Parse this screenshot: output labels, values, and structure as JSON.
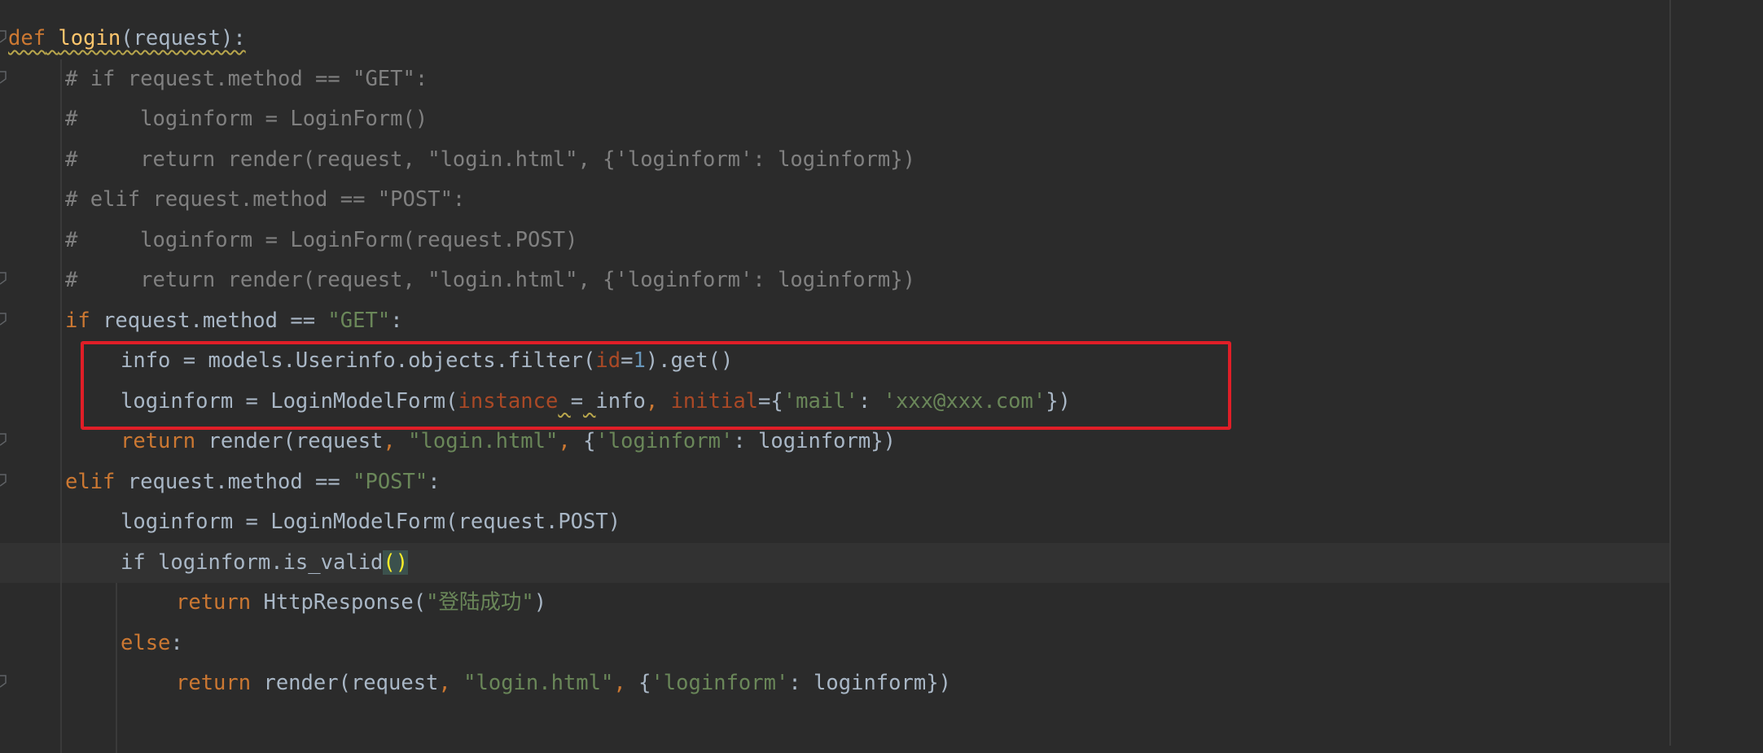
{
  "editor": {
    "language": "python",
    "colors": {
      "background": "#2b2b2b",
      "current_line": "#323232",
      "keyword": "#cc7832",
      "function_name": "#ffc66d",
      "string": "#6a8759",
      "number": "#6897bb",
      "named_argument": "#aa4926",
      "comment": "#808080",
      "default_text": "#a9b7c6",
      "highlight_box": "#e01e27"
    },
    "highlighted_lines": [
      9,
      10
    ],
    "caret_line": 13,
    "lines": [
      {
        "text": "def login(request):"
      },
      {
        "text": "# if request.method == \"GET\":"
      },
      {
        "text": "#     loginform = LoginForm()"
      },
      {
        "text": "#     return render(request, \"login.html\", {'loginform': loginform})"
      },
      {
        "text": "# elif request.method == \"POST\":"
      },
      {
        "text": "#     loginform = LoginForm(request.POST)"
      },
      {
        "text": "#     return render(request, \"login.html\", {'loginform': loginform})"
      },
      {
        "text": "if request.method == \"GET\":"
      },
      {
        "text": "info = models.Userinfo.objects.filter(id=1).get()"
      },
      {
        "text": "loginform = LoginModelForm(instance = info, initial={'mail': 'xxx@xxx.com'})"
      },
      {
        "text": "return render(request, \"login.html\", {'loginform': loginform})"
      },
      {
        "text": "elif request.method == \"POST\":"
      },
      {
        "text": "loginform = LoginModelForm(request.POST)"
      },
      {
        "text": "if loginform.is_valid():"
      },
      {
        "text": "return HttpResponse(\"登陆成功\")"
      },
      {
        "text": "else:"
      },
      {
        "text": "return render(request, \"login.html\", {'loginform': loginform})"
      }
    ]
  }
}
